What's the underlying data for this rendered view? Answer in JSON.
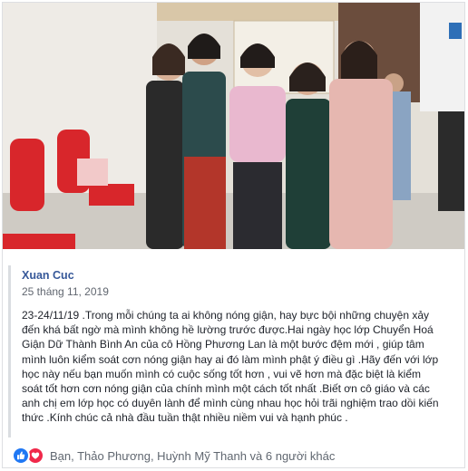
{
  "photo": {
    "alt": "group-photo"
  },
  "post": {
    "author": "Xuan Cuc",
    "date": "25 tháng 11, 2019",
    "text": "23-24/11/19 .Trong mỗi chúng ta ai không nóng giận, hay bực bội những chuyện xảy đến khá bất ngờ mà mình không hề lường trước được.Hai ngày học lớp Chuyển Hoá Giận Dữ Thành Bình An của cô Hồng Phương Lan là một bước đệm mới , giúp tâm mình luôn kiểm soát cơn nóng giận hay ai đó làm mình phật ý điều gì .Hãy đến với lớp học này nếu bạn muốn mình có cuộc sống tốt hơn , vui vẽ hơn mà đặc biệt là kiểm soát tốt hơn cơn nóng giận của chính mình một cách tốt nhất .Biết ơn cô giáo và các anh chị em lớp học có duyên lành để mình cùng nhau học hỏi trãi nghiệm trao dồi kiến thức .Kính chúc cả nhà đầu tuần thật nhiều niềm vui và hạnh phúc ."
  },
  "reactions": {
    "names": "Bạn, Thảo Phương, Huỳnh Mỹ Thanh và 6 người khác",
    "icons": [
      "like-icon",
      "love-icon"
    ],
    "like_color": "#2078f4",
    "love_color": "#f0284a"
  }
}
